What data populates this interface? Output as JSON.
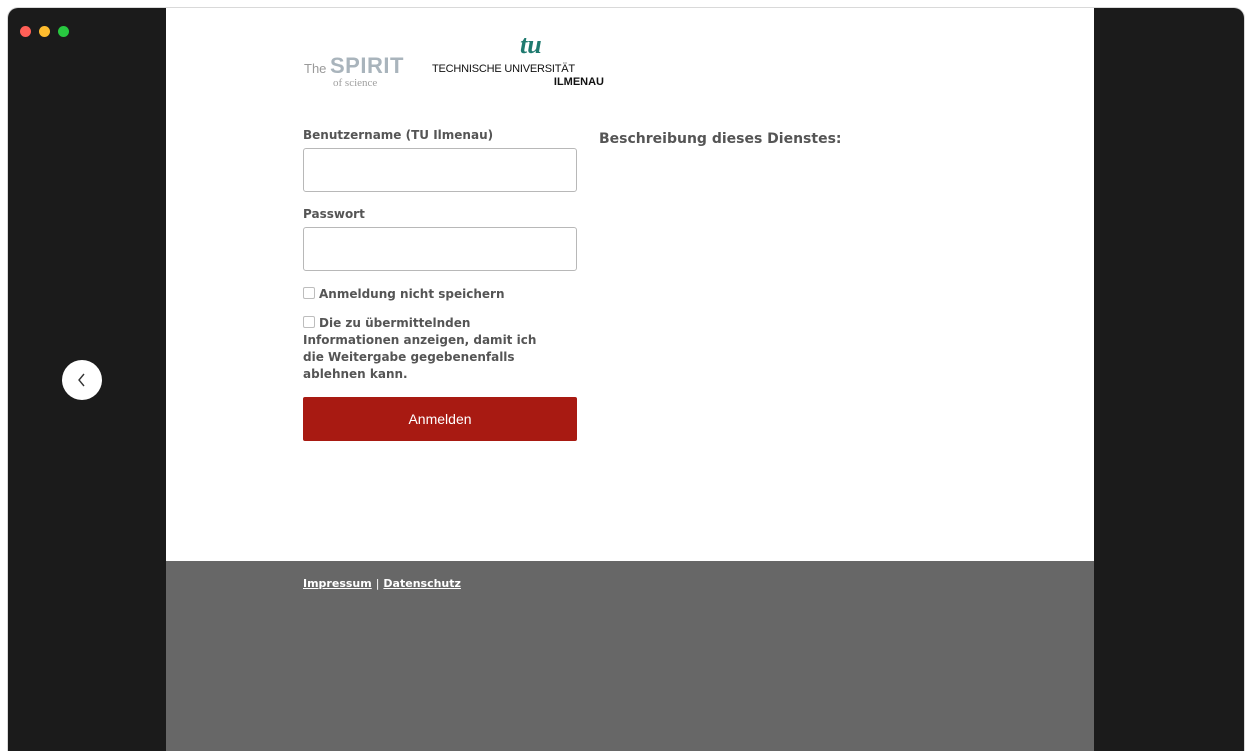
{
  "window": {
    "controls": [
      "close",
      "minimize",
      "zoom"
    ]
  },
  "nav": {
    "back_icon": "chevron-left-icon"
  },
  "logos": {
    "spirit": {
      "the": "The",
      "spirit": "SPIRIT",
      "of_science": "of science"
    },
    "tu": {
      "mark": "tu",
      "line1": "TECHNISCHE UNIVERSITÄT",
      "line2": "ILMENAU"
    }
  },
  "form": {
    "username_label": "Benutzername (TU Ilmenau)",
    "username_value": "",
    "password_label": "Passwort",
    "password_value": "",
    "dont_save_label": "Anmeldung nicht speichern",
    "show_info_label": "Die zu übermittelnden Informationen anzeigen, damit ich die Weitergabe gegebenenfalls ablehnen kann.",
    "submit_label": "Anmelden"
  },
  "description": {
    "title": "Beschreibung dieses Dienstes:"
  },
  "footer": {
    "impressum": "Impressum",
    "separator": "|",
    "datenschutz": "Datenschutz"
  },
  "colors": {
    "accent": "#a81a12",
    "footer_bg": "#676767",
    "frame_bg": "#1b1b1b",
    "tu_green": "#1f7a6f"
  }
}
